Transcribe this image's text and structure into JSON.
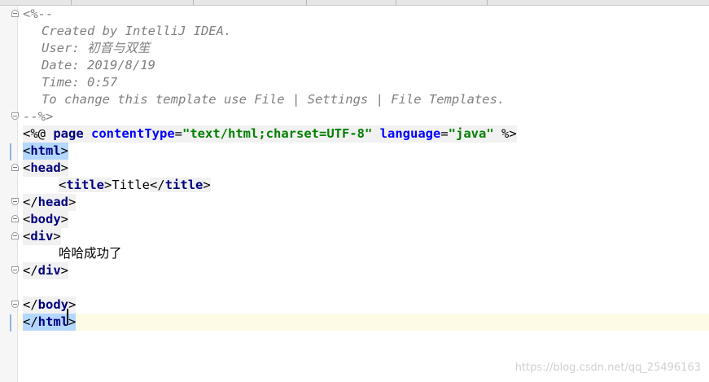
{
  "editor": {
    "comment": {
      "open": "<%--",
      "created": "Created by IntelliJ IDEA.",
      "user_label": "User: ",
      "user_value": "初音与双笙",
      "date": "Date: 2019/8/19",
      "time": "Time: 0:57",
      "change": "To change this template use File | Settings | File Templates.",
      "close": "--%>"
    },
    "directive": {
      "open": "<%@",
      "name": "page",
      "attr1": "contentType",
      "value1": "\"text/html;charset=UTF-8\"",
      "attr2": "language",
      "value2": "\"java\"",
      "close": "%>"
    },
    "markup": {
      "html": "html",
      "head": "head",
      "title": "title",
      "title_text": "Title",
      "body": "body",
      "div": "div",
      "div_text": "哈哈成功了"
    }
  },
  "watermark": "https://blog.csdn.net/qq_25496163"
}
